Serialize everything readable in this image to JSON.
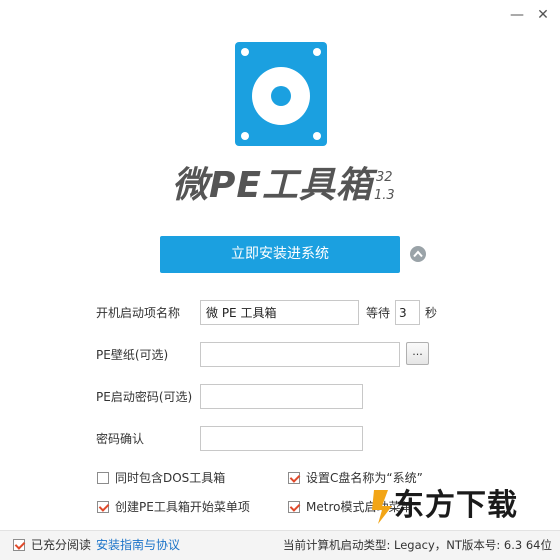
{
  "window": {
    "minimize_glyph": "—",
    "close_glyph": "✕"
  },
  "app": {
    "title": "微PE工具箱",
    "version_arch": "32",
    "version_number": "1.3"
  },
  "actions": {
    "install_label": "立即安装进系统"
  },
  "form": {
    "boot_name_label": "开机启动项名称",
    "boot_name_value": "微 PE 工具箱",
    "wait_label": "等待",
    "wait_value": "3",
    "seconds_label": "秒",
    "wallpaper_label": "PE壁纸(可选)",
    "wallpaper_value": "",
    "browse_label": "...",
    "password_label": "PE启动密码(可选)",
    "password_value": "",
    "confirm_label": "密码确认",
    "confirm_value": ""
  },
  "options": [
    {
      "label": "同时包含DOS工具箱",
      "checked": false
    },
    {
      "label": "设置C盘名称为“系统”",
      "checked": true
    },
    {
      "label": "创建PE工具箱开始菜单项",
      "checked": true
    },
    {
      "label": "Metro模式启动菜单",
      "checked": true
    }
  ],
  "footer": {
    "agree_label": "已充分阅读",
    "agree_checked": true,
    "guide_link": "安装指南与协议",
    "status": "当前计算机启动类型: Legacy，NT版本号: 6.3 64位"
  },
  "watermark": {
    "text": "东方下载"
  },
  "colors": {
    "accent": "#1ba0e0",
    "checkmark": "#e04a2b",
    "link": "#1a73c8"
  }
}
